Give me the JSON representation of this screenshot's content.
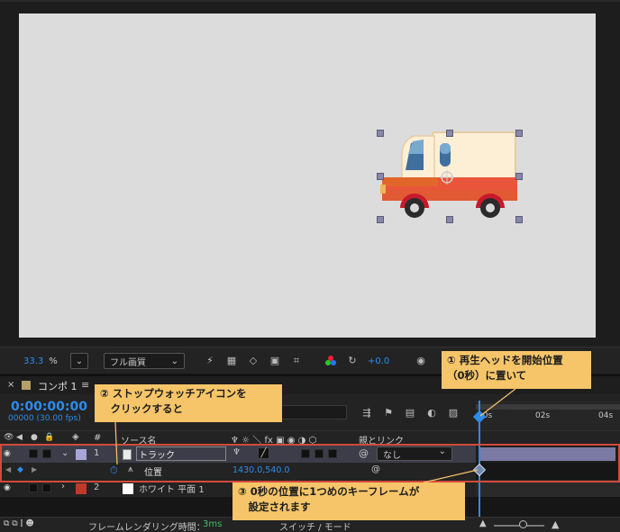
{
  "viewer": {
    "zoom": "33.3",
    "zoom_unit": "%",
    "resolution": "フル画質",
    "exposure": "+0.0"
  },
  "timeline": {
    "tab_label": "コンポ 1",
    "timecode": "0:00:00:00",
    "frame_info": "00000 (30.00 fps)",
    "ruler_marks": [
      "00s",
      "02s",
      "04s"
    ],
    "columns": {
      "hash": "#",
      "source_name": "ソース名",
      "parent_link": "親とリンク"
    },
    "layers": [
      {
        "index": "1",
        "name": "トラック",
        "parent": "なし",
        "label_color": "#a7a7d6"
      },
      {
        "index": "2",
        "name": "ホワイト 平面 1",
        "label_color": "#c0392b"
      }
    ],
    "property": {
      "name": "位置",
      "value": "1430.0,540.0"
    },
    "status": {
      "render_label": "フレームレンダリング時間：",
      "render_value": "3ms",
      "mode_label": "スイッチ / モード"
    }
  },
  "callouts": {
    "c1": [
      "① 再生ヘッドを開始位置",
      "（0秒）に置いて"
    ],
    "c2": [
      "② ストップウォッチアイコンを",
      "　クリックすると"
    ],
    "c3": [
      "③ 0秒の位置に1つめのキーフレームが",
      "　設定されます"
    ]
  },
  "colors": {
    "accent": "#2d8ceb",
    "callout": "#f6c56a",
    "highlight": "#d24a3a",
    "playhead": "#2d8ceb"
  }
}
